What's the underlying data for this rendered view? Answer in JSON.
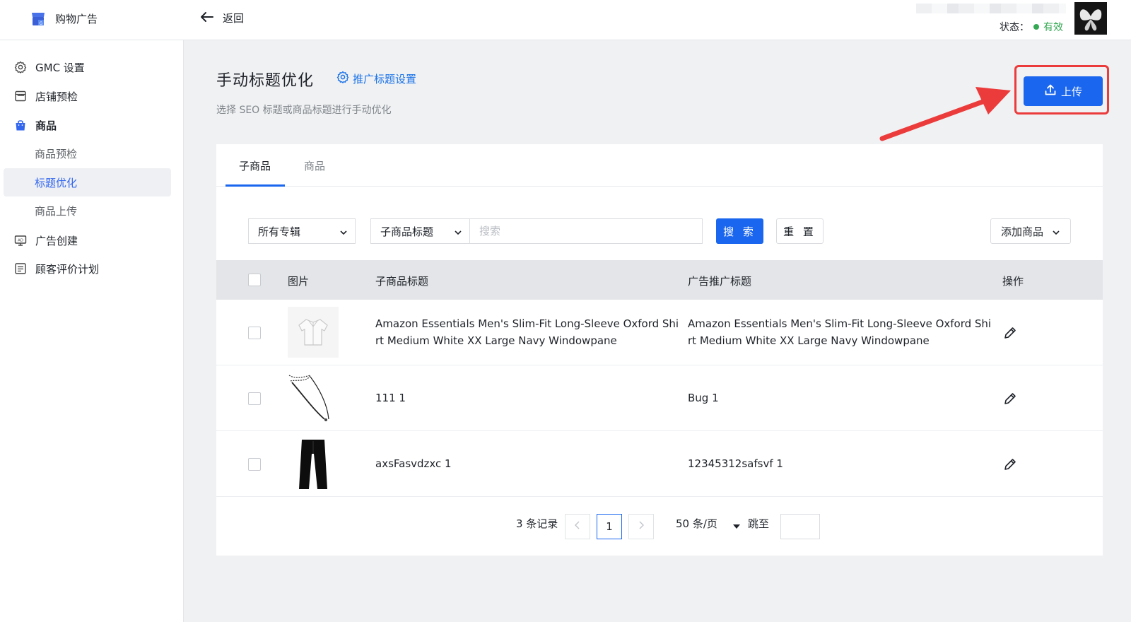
{
  "header": {
    "app_title": "购物广告",
    "back_label": "返回",
    "status_label": "状态：",
    "status_value": "有效",
    "status_color": "#34a853"
  },
  "sidebar": {
    "items": [
      {
        "label": "GMC 设置",
        "icon": "gear-icon"
      },
      {
        "label": "店铺预检",
        "icon": "store-icon"
      },
      {
        "label": "商品",
        "icon": "shopping-bag-icon"
      },
      {
        "label": "商品预检",
        "sub": true
      },
      {
        "label": "标题优化",
        "sub": true,
        "active": true
      },
      {
        "label": "商品上传",
        "sub": true
      },
      {
        "label": "广告创建",
        "icon": "ad-icon"
      },
      {
        "label": "顾客评价计划",
        "icon": "review-icon"
      }
    ]
  },
  "main": {
    "title": "手动标题优化",
    "settings_link": "推广标题设置",
    "subtitle": "选择 SEO 标题或商品标题进行手动优化",
    "upload_label": "上传",
    "tabs": [
      {
        "label": "子商品",
        "active": true
      },
      {
        "label": "商品",
        "active": false
      }
    ],
    "filters": {
      "collection_select": "所有专辑",
      "field_select": "子商品标题",
      "search_placeholder": "搜索",
      "search_button": "搜 索",
      "reset_button": "重 置",
      "add_button": "添加商品"
    },
    "table": {
      "columns": [
        "图片",
        "子商品标题",
        "广告推广标题",
        "操作"
      ],
      "rows": [
        {
          "image": "shirt-thumbnail",
          "sub_title_line1": "Amazon Essentials Men's Slim-Fit Long-Sleeve Oxford Shi",
          "sub_title_line2": "rt Medium White XX Large Navy Windowpane",
          "ad_title_line1": "Amazon Essentials Men's Slim-Fit Long-Sleeve Oxford Shi",
          "ad_title_line2": "rt Medium White XX Large Navy Windowpane"
        },
        {
          "image": "necklace-thumbnail",
          "sub_title_line1": "111 1",
          "ad_title_line1": "Bug 1"
        },
        {
          "image": "pants-thumbnail",
          "sub_title_line1": "axsFasvdzxc 1",
          "ad_title_line1": "12345312safsvf 1"
        }
      ]
    },
    "pagination": {
      "total": "3 条记录",
      "current_page": "1",
      "page_size": "50 条/页",
      "jump_label": "跳至"
    },
    "accent_color": "#1a66ee",
    "highlight_color": "#ec3b3b"
  }
}
